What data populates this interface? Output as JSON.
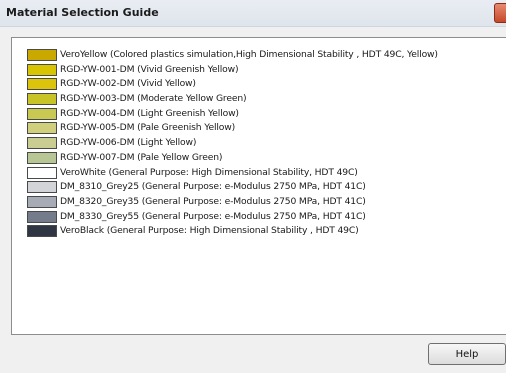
{
  "window": {
    "title": "Material Selection Guide"
  },
  "materials": [
    {
      "label": "VeroYellow (Colored plastics simulation,High Dimensional Stability , HDT 49C, Yellow)",
      "color": "#c9a800"
    },
    {
      "label": "RGD-YW-001-DM (Vivid Greenish Yellow)",
      "color": "#d8c400"
    },
    {
      "label": "RGD-YW-002-DM (Vivid  Yellow)",
      "color": "#dcc40c"
    },
    {
      "label": "RGD-YW-003-DM (Moderate Yellow Green)",
      "color": "#c8c426"
    },
    {
      "label": "RGD-YW-004-DM (Light Greenish Yellow)",
      "color": "#c8c852"
    },
    {
      "label": "RGD-YW-005-DM (Pale Greenish Yellow)",
      "color": "#cfcf7c"
    },
    {
      "label": "RGD-YW-006-DM (Light Yellow)",
      "color": "#c9cd92"
    },
    {
      "label": "RGD-YW-007-DM (Pale Yellow Green)",
      "color": "#b8c696"
    },
    {
      "label": "VeroWhite (General Purpose: High Dimensional Stability, HDT 49C)",
      "color": "#ffffff"
    },
    {
      "label": "DM_8310_Grey25 (General Purpose: e-Modulus 2750 MPa, HDT 41C)",
      "color": "#d2d4d8"
    },
    {
      "label": "DM_8320_Grey35 (General Purpose: e-Modulus 2750 MPa, HDT 41C)",
      "color": "#a6abb5"
    },
    {
      "label": "DM_8330_Grey55 (General Purpose: e-Modulus 2750 MPa, HDT 41C)",
      "color": "#747c8c"
    },
    {
      "label": "VeroBlack (General Purpose: High Dimensional Stability , HDT 49C)",
      "color": "#2f3542"
    }
  ],
  "help_button": {
    "label": "Help"
  }
}
